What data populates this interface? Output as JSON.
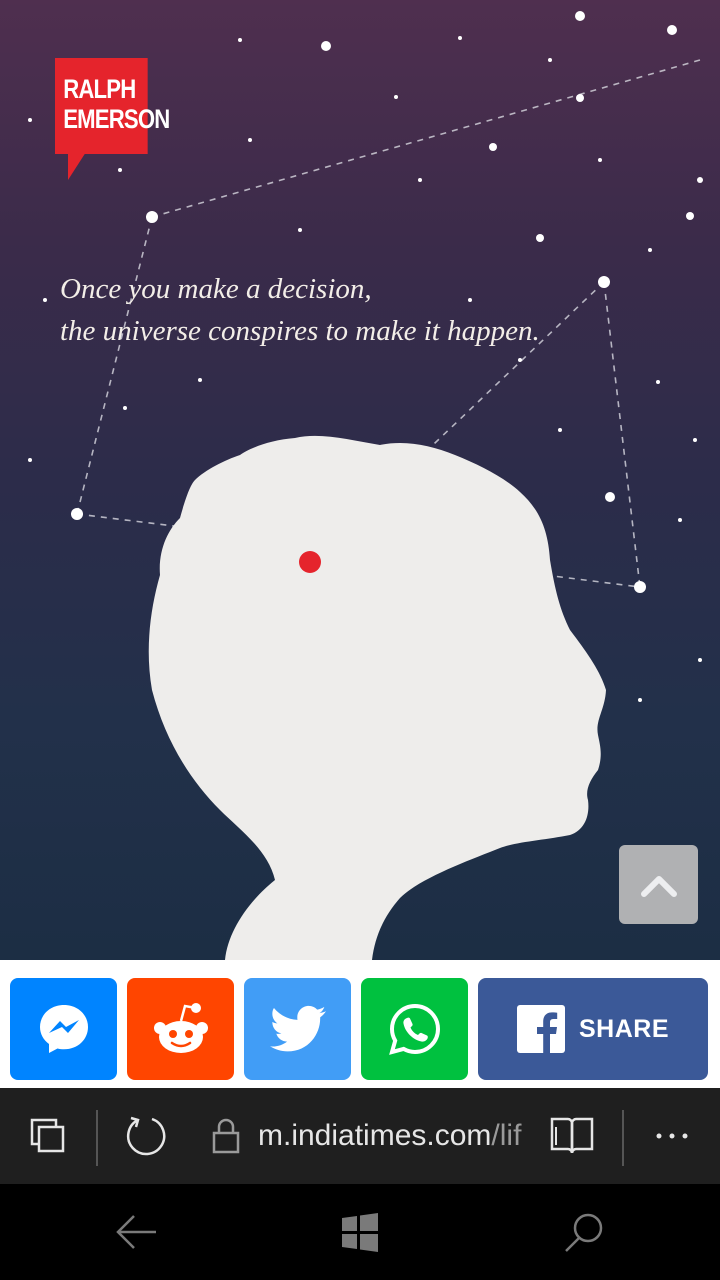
{
  "poster": {
    "author_line1": "RALPH",
    "author_line2": "EMERSON",
    "quote_line1": "Once you make a decision,",
    "quote_line2": "the universe conspires to make it happen."
  },
  "share": {
    "facebook_label": "SHARE",
    "messenger_color": "#0084ff",
    "reddit_color": "#ff4500",
    "twitter_color": "#419df6",
    "whatsapp_color": "#00c13f",
    "facebook_color": "#3b5998"
  },
  "browser": {
    "url_host": "m.indiatimes.com",
    "url_path": "/lif"
  }
}
